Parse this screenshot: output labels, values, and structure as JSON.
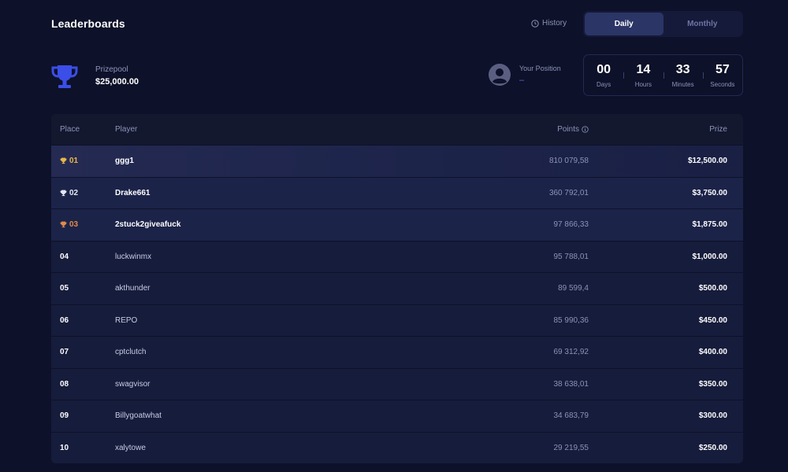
{
  "header": {
    "title": "Leaderboards",
    "history_label": "History",
    "tabs": [
      {
        "label": "Daily",
        "active": true
      },
      {
        "label": "Monthly",
        "active": false
      }
    ]
  },
  "prizepool": {
    "label": "Prizepool",
    "value": "$25,000.00"
  },
  "position": {
    "label": "Your Position",
    "value": "–"
  },
  "timer": [
    {
      "value": "00",
      "unit": "Days"
    },
    {
      "value": "14",
      "unit": "Hours"
    },
    {
      "value": "33",
      "unit": "Minutes"
    },
    {
      "value": "57",
      "unit": "Seconds"
    }
  ],
  "table": {
    "columns": {
      "place": "Place",
      "player": "Player",
      "points": "Points",
      "prize": "Prize"
    },
    "rows": [
      {
        "place": "01",
        "player": "ggg1",
        "points": "810 079,58",
        "prize": "$12,500.00"
      },
      {
        "place": "02",
        "player": "Drake661",
        "points": "360 792,01",
        "prize": "$3,750.00"
      },
      {
        "place": "03",
        "player": "2stuck2giveafuck",
        "points": "97 866,33",
        "prize": "$1,875.00"
      },
      {
        "place": "04",
        "player": "luckwinmx",
        "points": "95 788,01",
        "prize": "$1,000.00"
      },
      {
        "place": "05",
        "player": "akthunder",
        "points": "89 599,4",
        "prize": "$500.00"
      },
      {
        "place": "06",
        "player": "REPO",
        "points": "85 990,36",
        "prize": "$450.00"
      },
      {
        "place": "07",
        "player": "cptclutch",
        "points": "69 312,92",
        "prize": "$400.00"
      },
      {
        "place": "08",
        "player": "swagvisor",
        "points": "38 638,01",
        "prize": "$350.00"
      },
      {
        "place": "09",
        "player": "Billygoatwhat",
        "points": "34 683,79",
        "prize": "$300.00"
      },
      {
        "place": "10",
        "player": "xalytowe",
        "points": "29 219,55",
        "prize": "$250.00"
      }
    ]
  },
  "colors": {
    "background": "#0d1129",
    "accent": "#3b4ee8",
    "gold": "#e8b64c",
    "silver": "#e6e8f2",
    "bronze": "#e08a4a"
  }
}
